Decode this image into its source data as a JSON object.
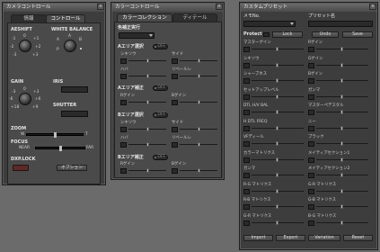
{
  "win1": {
    "title": "カメラコントロール",
    "tabs": [
      "情報",
      "コントロール"
    ],
    "aeshift": {
      "label": "AESHIFT",
      "scale": [
        "0",
        "-1",
        "+1",
        "-2",
        "+2",
        "-3",
        "+3"
      ]
    },
    "wb": {
      "label": "WHITE BALANCE",
      "knob_labels": [
        "A",
        "B"
      ],
      "a_label": "A",
      "preset_label": "P"
    },
    "gain": {
      "label": "GAIN",
      "scale": [
        "0",
        "+3",
        "-3",
        "+6",
        "-6",
        "+9",
        "+18"
      ]
    },
    "iris": {
      "label": "IRIS"
    },
    "shutter": {
      "label": "SHUTTER"
    },
    "zoom": {
      "label": "ZOOM",
      "w": "W",
      "t": "T"
    },
    "focus": {
      "label": "FOCUS",
      "near": "NEAR",
      "far": "FAR"
    },
    "dxplock": {
      "label": "DXP.LOCK"
    },
    "option_btn": "オプション"
  },
  "win2": {
    "title": "カラーコントロール",
    "tabs": [
      "カラーコレクション",
      "ディテール"
    ],
    "color_correct": "色補正実行",
    "a_area": "Aエリア選択",
    "a_comp": "Aエリア補正",
    "b_area": "Bエリア選択",
    "b_comp": "Bエリア補正",
    "off": "OFF",
    "hue": "シキソウ",
    "width": "ハバ",
    "sat": "サイド",
    "bright": "リベールレ",
    "r_gain": "Rゲイン",
    "b_gain": "Bゲイン",
    "x_unit": "±1"
  },
  "win3": {
    "title": "カスタムプリセット",
    "memo": "メモNo.",
    "preset_name": "プリセット名",
    "protect": "Protect",
    "lock": "Lock",
    "undo": "Undo",
    "save": "Save",
    "params": [
      [
        "マスターゲイン",
        "Rゲイン"
      ],
      [
        "シキソウ",
        "Gゲイン"
      ],
      [
        "シャープネス",
        "Bゲイン"
      ],
      [
        "セットアップレベル",
        "ガンマ"
      ],
      [
        "DTL H/V BAL",
        "マスターペデスタル"
      ],
      [
        "H DTL FREQ",
        "ニー"
      ],
      [
        "VFディール",
        "ブラック"
      ],
      [
        "カラーマトリクス",
        "メイティアセクション1"
      ],
      [
        "ガンマ",
        "メイティアセクション2"
      ],
      [
        "R-G マトリクス",
        "G-R マトリクス"
      ],
      [
        "R-B マトリクス",
        "G-B マトリクス"
      ],
      [
        "G-R マトリクス",
        "B-G マトリクス"
      ]
    ],
    "buttons": [
      "Import",
      "Export",
      "Variation",
      "Reset"
    ]
  }
}
